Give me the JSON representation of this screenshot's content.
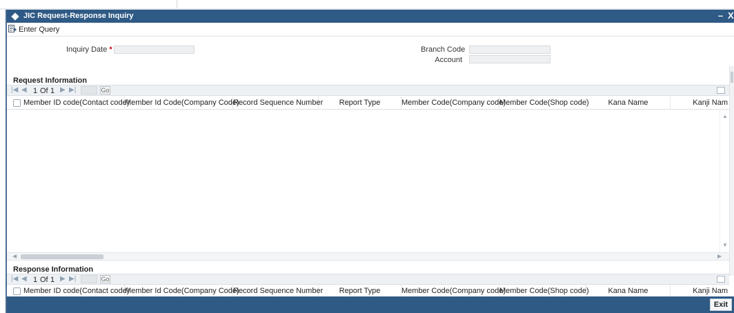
{
  "window": {
    "title": "JIC Request-Response Inquiry",
    "minimize_label": "–",
    "close_label": "X"
  },
  "toolbar": {
    "enter_query_label": "Enter Query"
  },
  "form": {
    "inquiry_date": {
      "label": "Inquiry Date",
      "required_marker": "*",
      "value": ""
    },
    "branch_code": {
      "label": "Branch Code",
      "value": ""
    },
    "account": {
      "label": "Account",
      "value": ""
    }
  },
  "request": {
    "title": "Request Information",
    "pager": {
      "current": "1",
      "of_label": "Of",
      "total": "1",
      "go_label": "Go"
    },
    "columns": [
      "Member ID code(Contact code)",
      "Member Id Code(Company Code)",
      "Record Sequence Number",
      "Report Type",
      "Member Code(Company code)",
      "Member Code(Shop code)",
      "Kana Name",
      "Kanji Nam"
    ]
  },
  "response": {
    "title": "Response Information",
    "pager": {
      "current": "1",
      "of_label": "Of",
      "total": "1",
      "go_label": "Go"
    },
    "columns": [
      "Member ID code(Contact code)",
      "Member Id Code(Company Code)",
      "Record Sequence Number",
      "Report Type",
      "Member Code(Company code)",
      "Member Code(Shop code)",
      "Kana Name",
      "Kanji Nam"
    ]
  },
  "footer": {
    "exit_label": "Exit"
  },
  "colors": {
    "titlebar": "#2f5a85",
    "footer": "#2f5a85",
    "required": "#d0021b"
  },
  "icons": {
    "title": "diamond-icon",
    "enter_query": "enter-query-icon",
    "pager": [
      "first-page-icon",
      "prev-page-icon",
      "next-page-icon",
      "last-page-icon"
    ]
  }
}
